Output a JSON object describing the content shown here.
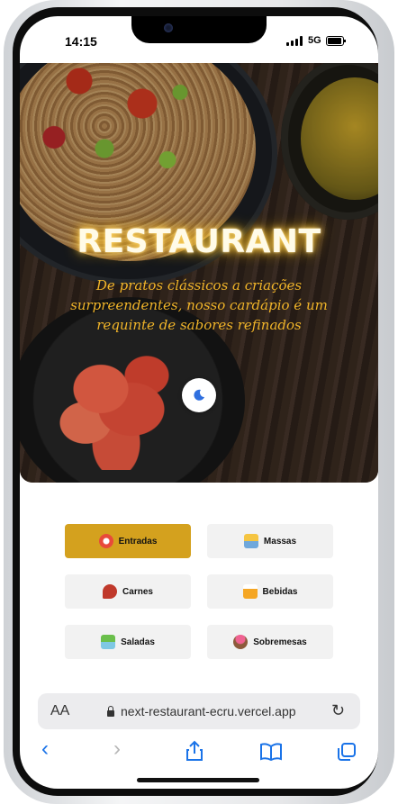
{
  "status": {
    "time": "14:15",
    "network": "5G"
  },
  "hero": {
    "title": "RESTAURANT",
    "subtitle": "De pratos clássicos a criações surpreendentes, nosso cardápio é um requinte de sabores refinados"
  },
  "categories": [
    {
      "label": "Entradas",
      "icon": "appetizer-icon",
      "active": true
    },
    {
      "label": "Massas",
      "icon": "pasta-icon",
      "active": false
    },
    {
      "label": "Carnes",
      "icon": "meat-icon",
      "active": false
    },
    {
      "label": "Bebidas",
      "icon": "drinks-icon",
      "active": false
    },
    {
      "label": "Saladas",
      "icon": "salad-icon",
      "active": false
    },
    {
      "label": "Sobremesas",
      "icon": "dessert-icon",
      "active": false
    }
  ],
  "browser": {
    "text_size": "AA",
    "url": "next-restaurant-ecru.vercel.app"
  },
  "colors": {
    "accent": "#d4a11e",
    "hero_text": "#f0b429",
    "nav": "#1a73e8"
  }
}
